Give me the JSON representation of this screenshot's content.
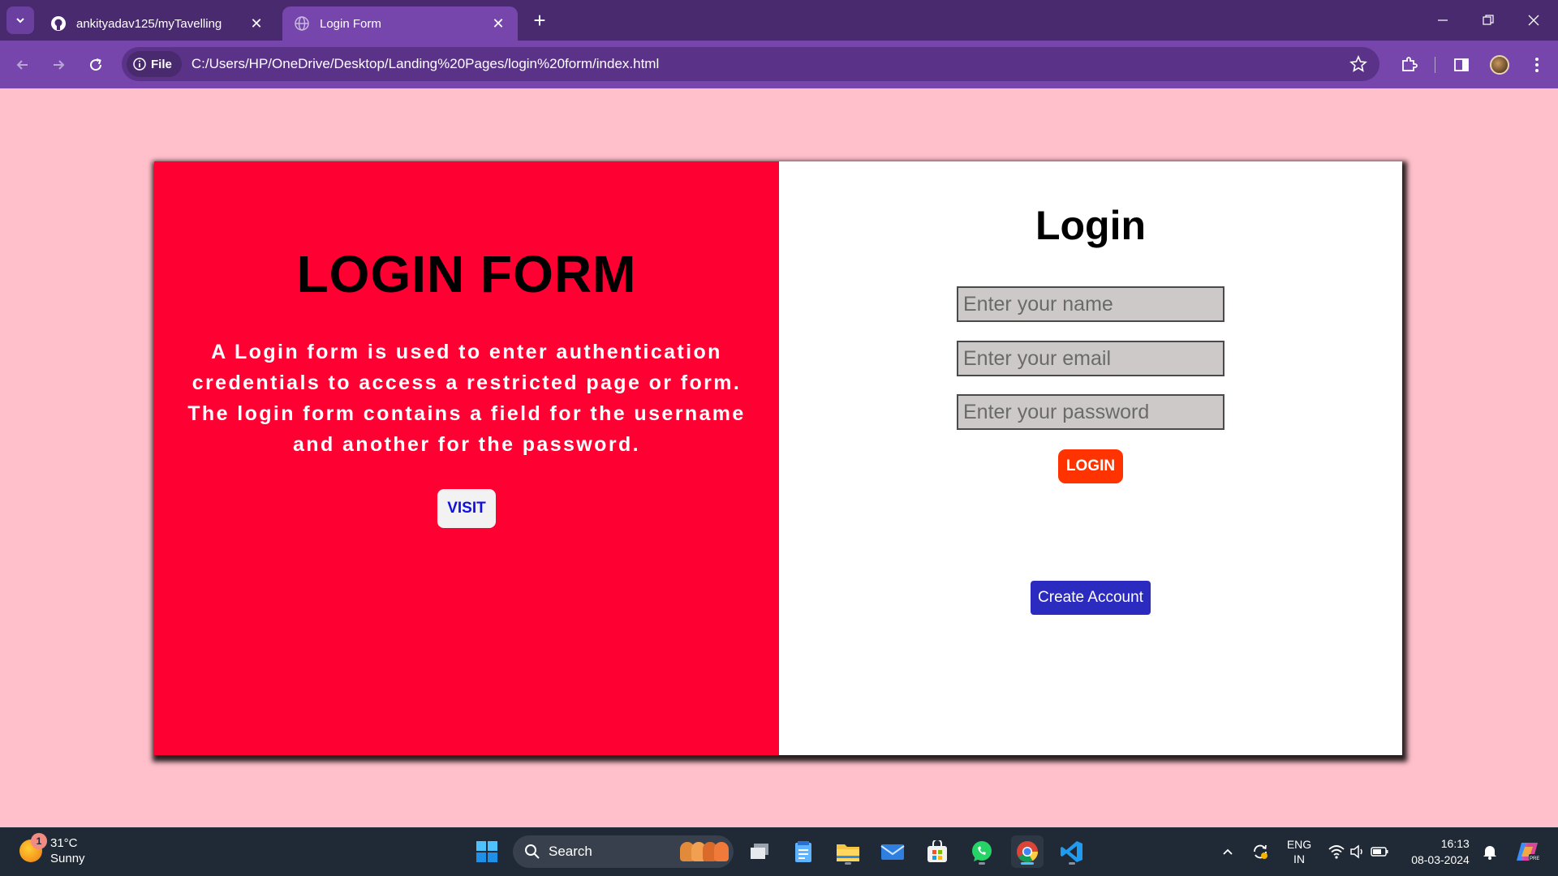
{
  "browser": {
    "tabs": [
      {
        "title": "ankityadav125/myTavelling",
        "icon": "github-icon",
        "active": false
      },
      {
        "title": "Login Form",
        "icon": "globe-icon",
        "active": true
      }
    ],
    "address_chip": "File",
    "url": "C:/Users/HP/OneDrive/Desktop/Landing%20Pages/login%20form/index.html"
  },
  "page": {
    "left": {
      "heading": "LOGIN FORM",
      "description": "A Login form is used to enter authentication credentials to access a restricted page or form. The login form contains a field for the username and another for the password.",
      "visit_label": "VISIT"
    },
    "right": {
      "heading": "Login",
      "name_placeholder": "Enter your name",
      "email_placeholder": "Enter your email",
      "password_placeholder": "Enter your password",
      "login_label": "LOGIN",
      "create_label": "Create Account"
    },
    "colors": {
      "background": "#ffc0cb",
      "left_panel": "#ff0033",
      "login_button": "#ff3300",
      "create_button": "#2b2bbf",
      "visit_text": "#1010dd"
    }
  },
  "taskbar": {
    "weather": {
      "badge": "1",
      "temp": "31°C",
      "condition": "Sunny"
    },
    "search_label": "Search",
    "lang_line1": "ENG",
    "lang_line2": "IN",
    "time": "16:13",
    "date": "08-03-2024"
  }
}
